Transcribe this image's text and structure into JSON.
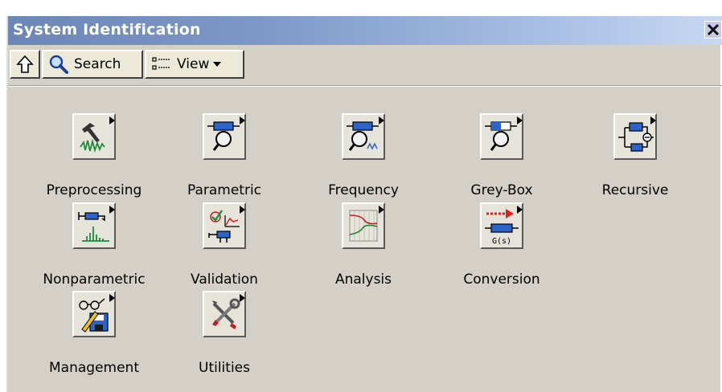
{
  "window": {
    "title": "System Identification"
  },
  "toolbar": {
    "search_label": "Search",
    "view_label": "View"
  },
  "palette": {
    "items": [
      {
        "label": "Preprocessing"
      },
      {
        "label": "Parametric"
      },
      {
        "label": "Frequency"
      },
      {
        "label": "Grey-Box"
      },
      {
        "label": "Recursive"
      },
      {
        "label": "Nonparametric"
      },
      {
        "label": "Validation"
      },
      {
        "label": "Analysis"
      },
      {
        "label": "Conversion"
      },
      {
        "label": "Management"
      },
      {
        "label": "Utilities"
      }
    ],
    "conversion_icon_text": "G(s)"
  },
  "colors": {
    "titlebar_start": "#6b86b7",
    "titlebar_end": "#c7d8f2",
    "panel": "#d4d0c8",
    "accent_green": "#1f8a3c",
    "accent_red": "#e02020",
    "accent_blue": "#2b63c8"
  }
}
